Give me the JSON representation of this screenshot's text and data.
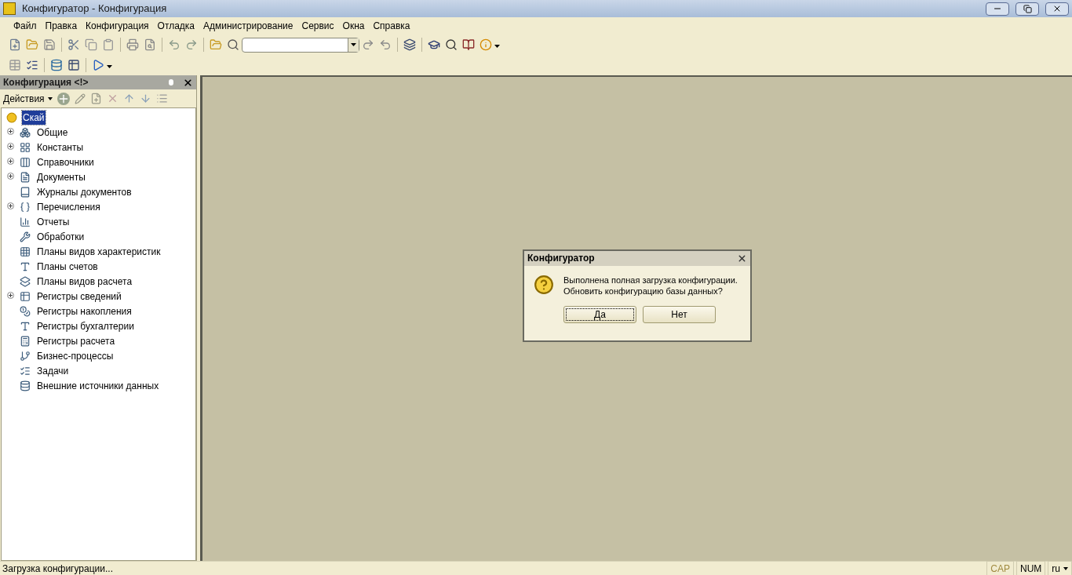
{
  "window": {
    "title": "Конфигуратор - Конфигурация"
  },
  "menu": [
    "Файл",
    "Правка",
    "Конфигурация",
    "Отладка",
    "Администрирование",
    "Сервис",
    "Окна",
    "Справка"
  ],
  "panel": {
    "title": "Конфигурация <!>",
    "actions_label": "Действия",
    "tree": {
      "label": "Скай",
      "selected": true,
      "children": [
        {
          "label": "Общие",
          "expandable": true,
          "selected": false
        },
        {
          "label": "Константы",
          "expandable": true,
          "selected": false
        },
        {
          "label": "Справочники",
          "expandable": true,
          "selected": false
        },
        {
          "label": "Документы",
          "expandable": true,
          "selected": false
        },
        {
          "label": "Журналы документов",
          "expandable": false,
          "selected": false
        },
        {
          "label": "Перечисления",
          "expandable": true,
          "selected": false
        },
        {
          "label": "Отчеты",
          "expandable": false,
          "selected": false
        },
        {
          "label": "Обработки",
          "expandable": false,
          "selected": false
        },
        {
          "label": "Планы видов характеристик",
          "expandable": false,
          "selected": false
        },
        {
          "label": "Планы счетов",
          "expandable": false,
          "selected": false
        },
        {
          "label": "Планы видов расчета",
          "expandable": false,
          "selected": false
        },
        {
          "label": "Регистры сведений",
          "expandable": true,
          "selected": false
        },
        {
          "label": "Регистры накопления",
          "expandable": false,
          "selected": false
        },
        {
          "label": "Регистры бухгалтерии",
          "expandable": false,
          "selected": false
        },
        {
          "label": "Регистры расчета",
          "expandable": false,
          "selected": false
        },
        {
          "label": "Бизнес-процессы",
          "expandable": false,
          "selected": false
        },
        {
          "label": "Задачи",
          "expandable": false,
          "selected": false
        },
        {
          "label": "Внешние источники данных",
          "expandable": false,
          "selected": false
        }
      ]
    }
  },
  "dialog": {
    "title": "Конфигуратор",
    "message": [
      "Выполнена полная загрузка конфигурации.",
      "Обновить конфигурацию базы данных?"
    ],
    "buttons": [
      {
        "label": "Да",
        "focused": true
      },
      {
        "label": "Нет",
        "focused": false
      }
    ]
  },
  "status_bar": {
    "text": "Загрузка конфигурации...",
    "indicators": [
      {
        "label": "CAP",
        "on": false
      },
      {
        "label": "NUM",
        "on": true
      }
    ],
    "language": "ru"
  }
}
